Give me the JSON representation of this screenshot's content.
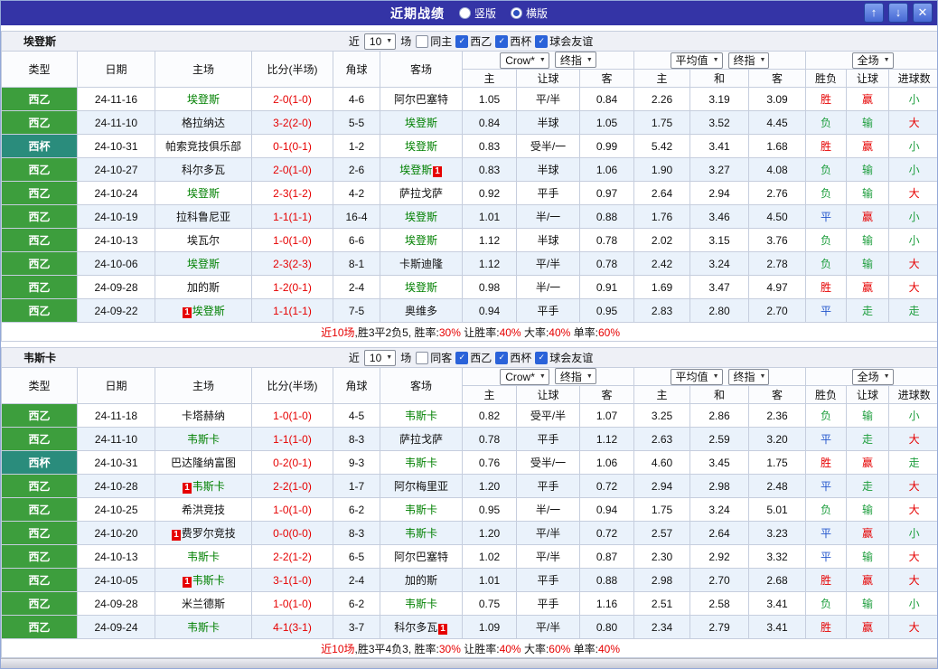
{
  "titlebar": {
    "title": "近期战绩",
    "mode_vertical": "竖版",
    "mode_horizontal": "横版",
    "selected_mode": "横版",
    "up_icon": "↑",
    "down_icon": "↓",
    "close_icon": "✕"
  },
  "filters": {
    "near_label": "近",
    "count": "10",
    "matches_label": "场",
    "leagues": [
      "西乙",
      "西杯",
      "球会友谊"
    ],
    "leagues_checked": [
      true,
      true,
      true
    ]
  },
  "columns": {
    "type": "类型",
    "date": "日期",
    "home": "主场",
    "score": "比分(半场)",
    "corner": "角球",
    "away": "客场",
    "odds_source": "Crow*",
    "odds_time": "终指",
    "odds_sub": [
      "主",
      "让球",
      "客"
    ],
    "avg_source": "平均值",
    "avg_time": "终指",
    "avg_sub": [
      "主",
      "和",
      "客"
    ],
    "result_scope": "全场",
    "result_sub": [
      "胜负",
      "让球",
      "进球数"
    ]
  },
  "colors": {
    "titlebar_bg": "#3434a6",
    "league": {
      "西乙": "#3d9e3d",
      "西杯": "#2a8c7c"
    },
    "team_name": "#008000",
    "score": "#e60000",
    "win": "#e60000",
    "draw": "#2356cc",
    "lose": "#1e9e3e"
  },
  "sections": [
    {
      "team": "埃登斯",
      "same_filter": "同主",
      "same_checked": false,
      "rows": [
        {
          "league": "西乙",
          "date": "24-11-16",
          "home": {
            "name": "埃登斯",
            "is_team": true
          },
          "score": "2-0(1-0)",
          "corner": "4-6",
          "away": {
            "name": "阿尔巴塞特",
            "is_team": false
          },
          "crow": [
            "1.05",
            "平/半",
            "0.84"
          ],
          "avg": [
            "2.26",
            "3.19",
            "3.09"
          ],
          "outcome": [
            {
              "t": "胜",
              "c": "win"
            },
            {
              "t": "赢",
              "c": "win"
            },
            {
              "t": "小",
              "c": "lose"
            }
          ]
        },
        {
          "league": "西乙",
          "date": "24-11-10",
          "home": {
            "name": "格拉纳达",
            "is_team": false
          },
          "score": "3-2(2-0)",
          "corner": "5-5",
          "away": {
            "name": "埃登斯",
            "is_team": true
          },
          "crow": [
            "0.84",
            "半球",
            "1.05"
          ],
          "avg": [
            "1.75",
            "3.52",
            "4.45"
          ],
          "outcome": [
            {
              "t": "负",
              "c": "lose"
            },
            {
              "t": "输",
              "c": "lose"
            },
            {
              "t": "大",
              "c": "win"
            }
          ]
        },
        {
          "league": "西杯",
          "date": "24-10-31",
          "home": {
            "name": "帕索竞技俱乐部",
            "is_team": false
          },
          "score": "0-1(0-1)",
          "corner": "1-2",
          "away": {
            "name": "埃登斯",
            "is_team": true
          },
          "crow": [
            "0.83",
            "受半/一",
            "0.99"
          ],
          "avg": [
            "5.42",
            "3.41",
            "1.68"
          ],
          "outcome": [
            {
              "t": "胜",
              "c": "win"
            },
            {
              "t": "赢",
              "c": "win"
            },
            {
              "t": "小",
              "c": "lose"
            }
          ]
        },
        {
          "league": "西乙",
          "date": "24-10-27",
          "home": {
            "name": "科尔多瓦",
            "is_team": false
          },
          "score": "2-0(1-0)",
          "corner": "2-6",
          "away": {
            "name": "埃登斯",
            "is_team": true,
            "badge": "1",
            "badge_pos": "after"
          },
          "crow": [
            "0.83",
            "半球",
            "1.06"
          ],
          "avg": [
            "1.90",
            "3.27",
            "4.08"
          ],
          "outcome": [
            {
              "t": "负",
              "c": "lose"
            },
            {
              "t": "输",
              "c": "lose"
            },
            {
              "t": "小",
              "c": "lose"
            }
          ]
        },
        {
          "league": "西乙",
          "date": "24-10-24",
          "home": {
            "name": "埃登斯",
            "is_team": true
          },
          "score": "2-3(1-2)",
          "corner": "4-2",
          "away": {
            "name": "萨拉戈萨",
            "is_team": false
          },
          "crow": [
            "0.92",
            "平手",
            "0.97"
          ],
          "avg": [
            "2.64",
            "2.94",
            "2.76"
          ],
          "outcome": [
            {
              "t": "负",
              "c": "lose"
            },
            {
              "t": "输",
              "c": "lose"
            },
            {
              "t": "大",
              "c": "win"
            }
          ]
        },
        {
          "league": "西乙",
          "date": "24-10-19",
          "home": {
            "name": "拉科鲁尼亚",
            "is_team": false
          },
          "score": "1-1(1-1)",
          "corner": "16-4",
          "away": {
            "name": "埃登斯",
            "is_team": true
          },
          "crow": [
            "1.01",
            "半/一",
            "0.88"
          ],
          "avg": [
            "1.76",
            "3.46",
            "4.50"
          ],
          "outcome": [
            {
              "t": "平",
              "c": "draw"
            },
            {
              "t": "赢",
              "c": "win"
            },
            {
              "t": "小",
              "c": "lose"
            }
          ]
        },
        {
          "league": "西乙",
          "date": "24-10-13",
          "home": {
            "name": "埃瓦尔",
            "is_team": false
          },
          "score": "1-0(1-0)",
          "corner": "6-6",
          "away": {
            "name": "埃登斯",
            "is_team": true
          },
          "crow": [
            "1.12",
            "半球",
            "0.78"
          ],
          "avg": [
            "2.02",
            "3.15",
            "3.76"
          ],
          "outcome": [
            {
              "t": "负",
              "c": "lose"
            },
            {
              "t": "输",
              "c": "lose"
            },
            {
              "t": "小",
              "c": "lose"
            }
          ]
        },
        {
          "league": "西乙",
          "date": "24-10-06",
          "home": {
            "name": "埃登斯",
            "is_team": true
          },
          "score": "2-3(2-3)",
          "corner": "8-1",
          "away": {
            "name": "卡斯迪隆",
            "is_team": false
          },
          "crow": [
            "1.12",
            "平/半",
            "0.78"
          ],
          "avg": [
            "2.42",
            "3.24",
            "2.78"
          ],
          "outcome": [
            {
              "t": "负",
              "c": "lose"
            },
            {
              "t": "输",
              "c": "lose"
            },
            {
              "t": "大",
              "c": "win"
            }
          ]
        },
        {
          "league": "西乙",
          "date": "24-09-28",
          "home": {
            "name": "加的斯",
            "is_team": false
          },
          "score": "1-2(0-1)",
          "corner": "2-4",
          "away": {
            "name": "埃登斯",
            "is_team": true
          },
          "crow": [
            "0.98",
            "半/一",
            "0.91"
          ],
          "avg": [
            "1.69",
            "3.47",
            "4.97"
          ],
          "outcome": [
            {
              "t": "胜",
              "c": "win"
            },
            {
              "t": "赢",
              "c": "win"
            },
            {
              "t": "大",
              "c": "win"
            }
          ]
        },
        {
          "league": "西乙",
          "date": "24-09-22",
          "home": {
            "name": "埃登斯",
            "is_team": true,
            "badge": "1",
            "badge_pos": "before"
          },
          "score": "1-1(1-1)",
          "corner": "7-5",
          "away": {
            "name": "奥维多",
            "is_team": false
          },
          "crow": [
            "0.94",
            "平手",
            "0.95"
          ],
          "avg": [
            "2.83",
            "2.80",
            "2.70"
          ],
          "outcome": [
            {
              "t": "平",
              "c": "draw"
            },
            {
              "t": "走",
              "c": "lose"
            },
            {
              "t": "走",
              "c": "lose"
            }
          ]
        }
      ],
      "summary": {
        "prefix": "近10场",
        "record": ",胜3平2负5, ",
        "stats": [
          {
            "label": "胜率:",
            "value": "30%"
          },
          {
            "label": " 让胜率:",
            "value": "40%"
          },
          {
            "label": " 大率:",
            "value": "40%"
          },
          {
            "label": " 单率:",
            "value": "60%"
          }
        ]
      }
    },
    {
      "team": "韦斯卡",
      "same_filter": "同客",
      "same_checked": false,
      "rows": [
        {
          "league": "西乙",
          "date": "24-11-18",
          "home": {
            "name": "卡塔赫纳",
            "is_team": false
          },
          "score": "1-0(1-0)",
          "corner": "4-5",
          "away": {
            "name": "韦斯卡",
            "is_team": true
          },
          "crow": [
            "0.82",
            "受平/半",
            "1.07"
          ],
          "avg": [
            "3.25",
            "2.86",
            "2.36"
          ],
          "outcome": [
            {
              "t": "负",
              "c": "lose"
            },
            {
              "t": "输",
              "c": "lose"
            },
            {
              "t": "小",
              "c": "lose"
            }
          ]
        },
        {
          "league": "西乙",
          "date": "24-11-10",
          "home": {
            "name": "韦斯卡",
            "is_team": true
          },
          "score": "1-1(1-0)",
          "corner": "8-3",
          "away": {
            "name": "萨拉戈萨",
            "is_team": false
          },
          "crow": [
            "0.78",
            "平手",
            "1.12"
          ],
          "avg": [
            "2.63",
            "2.59",
            "3.20"
          ],
          "outcome": [
            {
              "t": "平",
              "c": "draw"
            },
            {
              "t": "走",
              "c": "lose"
            },
            {
              "t": "大",
              "c": "win"
            }
          ]
        },
        {
          "league": "西杯",
          "date": "24-10-31",
          "home": {
            "name": "巴达隆纳富图",
            "is_team": false
          },
          "score": "0-2(0-1)",
          "corner": "9-3",
          "away": {
            "name": "韦斯卡",
            "is_team": true
          },
          "crow": [
            "0.76",
            "受半/一",
            "1.06"
          ],
          "avg": [
            "4.60",
            "3.45",
            "1.75"
          ],
          "outcome": [
            {
              "t": "胜",
              "c": "win"
            },
            {
              "t": "赢",
              "c": "win"
            },
            {
              "t": "走",
              "c": "lose"
            }
          ]
        },
        {
          "league": "西乙",
          "date": "24-10-28",
          "home": {
            "name": "韦斯卡",
            "is_team": true,
            "badge": "1",
            "badge_pos": "before"
          },
          "score": "2-2(1-0)",
          "corner": "1-7",
          "away": {
            "name": "阿尔梅里亚",
            "is_team": false
          },
          "crow": [
            "1.20",
            "平手",
            "0.72"
          ],
          "avg": [
            "2.94",
            "2.98",
            "2.48"
          ],
          "outcome": [
            {
              "t": "平",
              "c": "draw"
            },
            {
              "t": "走",
              "c": "lose"
            },
            {
              "t": "大",
              "c": "win"
            }
          ]
        },
        {
          "league": "西乙",
          "date": "24-10-25",
          "home": {
            "name": "希洪竞技",
            "is_team": false
          },
          "score": "1-0(1-0)",
          "corner": "6-2",
          "away": {
            "name": "韦斯卡",
            "is_team": true
          },
          "crow": [
            "0.95",
            "半/一",
            "0.94"
          ],
          "avg": [
            "1.75",
            "3.24",
            "5.01"
          ],
          "outcome": [
            {
              "t": "负",
              "c": "lose"
            },
            {
              "t": "输",
              "c": "lose"
            },
            {
              "t": "大",
              "c": "win"
            }
          ]
        },
        {
          "league": "西乙",
          "date": "24-10-20",
          "home": {
            "name": "费罗尔竞技",
            "is_team": false,
            "badge": "1",
            "badge_pos": "before"
          },
          "score": "0-0(0-0)",
          "corner": "8-3",
          "away": {
            "name": "韦斯卡",
            "is_team": true
          },
          "crow": [
            "1.20",
            "平/半",
            "0.72"
          ],
          "avg": [
            "2.57",
            "2.64",
            "3.23"
          ],
          "outcome": [
            {
              "t": "平",
              "c": "draw"
            },
            {
              "t": "赢",
              "c": "win"
            },
            {
              "t": "小",
              "c": "lose"
            }
          ]
        },
        {
          "league": "西乙",
          "date": "24-10-13",
          "home": {
            "name": "韦斯卡",
            "is_team": true
          },
          "score": "2-2(1-2)",
          "corner": "6-5",
          "away": {
            "name": "阿尔巴塞特",
            "is_team": false
          },
          "crow": [
            "1.02",
            "平/半",
            "0.87"
          ],
          "avg": [
            "2.30",
            "2.92",
            "3.32"
          ],
          "outcome": [
            {
              "t": "平",
              "c": "draw"
            },
            {
              "t": "输",
              "c": "lose"
            },
            {
              "t": "大",
              "c": "win"
            }
          ]
        },
        {
          "league": "西乙",
          "date": "24-10-05",
          "home": {
            "name": "韦斯卡",
            "is_team": true,
            "badge": "1",
            "badge_pos": "before"
          },
          "score": "3-1(1-0)",
          "corner": "2-4",
          "away": {
            "name": "加的斯",
            "is_team": false
          },
          "crow": [
            "1.01",
            "平手",
            "0.88"
          ],
          "avg": [
            "2.98",
            "2.70",
            "2.68"
          ],
          "outcome": [
            {
              "t": "胜",
              "c": "win"
            },
            {
              "t": "赢",
              "c": "win"
            },
            {
              "t": "大",
              "c": "win"
            }
          ]
        },
        {
          "league": "西乙",
          "date": "24-09-28",
          "home": {
            "name": "米兰德斯",
            "is_team": false
          },
          "score": "1-0(1-0)",
          "corner": "6-2",
          "away": {
            "name": "韦斯卡",
            "is_team": true
          },
          "crow": [
            "0.75",
            "平手",
            "1.16"
          ],
          "avg": [
            "2.51",
            "2.58",
            "3.41"
          ],
          "outcome": [
            {
              "t": "负",
              "c": "lose"
            },
            {
              "t": "输",
              "c": "lose"
            },
            {
              "t": "小",
              "c": "lose"
            }
          ]
        },
        {
          "league": "西乙",
          "date": "24-09-24",
          "home": {
            "name": "韦斯卡",
            "is_team": true
          },
          "score": "4-1(3-1)",
          "corner": "3-7",
          "away": {
            "name": "科尔多瓦",
            "is_team": false,
            "badge": "1",
            "badge_pos": "after"
          },
          "crow": [
            "1.09",
            "平/半",
            "0.80"
          ],
          "avg": [
            "2.34",
            "2.79",
            "3.41"
          ],
          "outcome": [
            {
              "t": "胜",
              "c": "win"
            },
            {
              "t": "赢",
              "c": "win"
            },
            {
              "t": "大",
              "c": "win"
            }
          ]
        }
      ],
      "summary": {
        "prefix": "近10场",
        "record": ",胜3平4负3, ",
        "stats": [
          {
            "label": "胜率:",
            "value": "30%"
          },
          {
            "label": " 让胜率:",
            "value": "40%"
          },
          {
            "label": " 大率:",
            "value": "60%"
          },
          {
            "label": " 单率:",
            "value": "40%"
          }
        ]
      }
    }
  ]
}
